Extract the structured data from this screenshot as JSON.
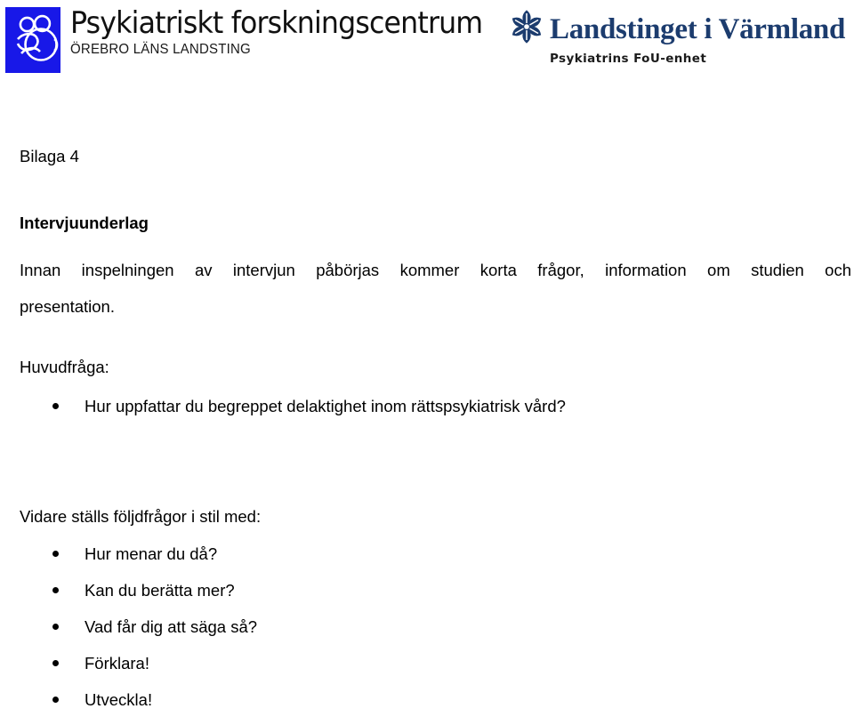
{
  "header": {
    "left_logo": {
      "mark_icon": "psychiatric-research-centre-figures-icon",
      "title": "Psykiatriskt forskningscentrum",
      "subtitle": "ÖREBRO LÄNS LANDSTING",
      "mark_color": "#1818E8"
    },
    "right_logo": {
      "mark_icon": "varmland-six-petal-flower-icon",
      "title": "Landstinget i Värmland",
      "subtitle": "Psykiatrins FoU-enhet",
      "mark_color": "#1C3C6E"
    }
  },
  "document": {
    "appendix_label": "Bilaga 4",
    "heading": "Intervjuunderlag",
    "intro_paragraph_line1": "Innan inspelningen av intervjun påbörjas kommer korta frågor, information om studien och",
    "intro_paragraph_line2": "presentation.",
    "main_question_label": "Huvudfråga:",
    "main_questions": [
      "Hur uppfattar du begreppet delaktighet inom rättspsykiatrisk vård?"
    ],
    "followup_label": "Vidare ställs följdfrågor i stil med:",
    "followup_questions": [
      "Hur menar du då?",
      "Kan du berätta mer?",
      "Vad får dig att säga så?",
      "Förklara!",
      "Utveckla!"
    ]
  }
}
